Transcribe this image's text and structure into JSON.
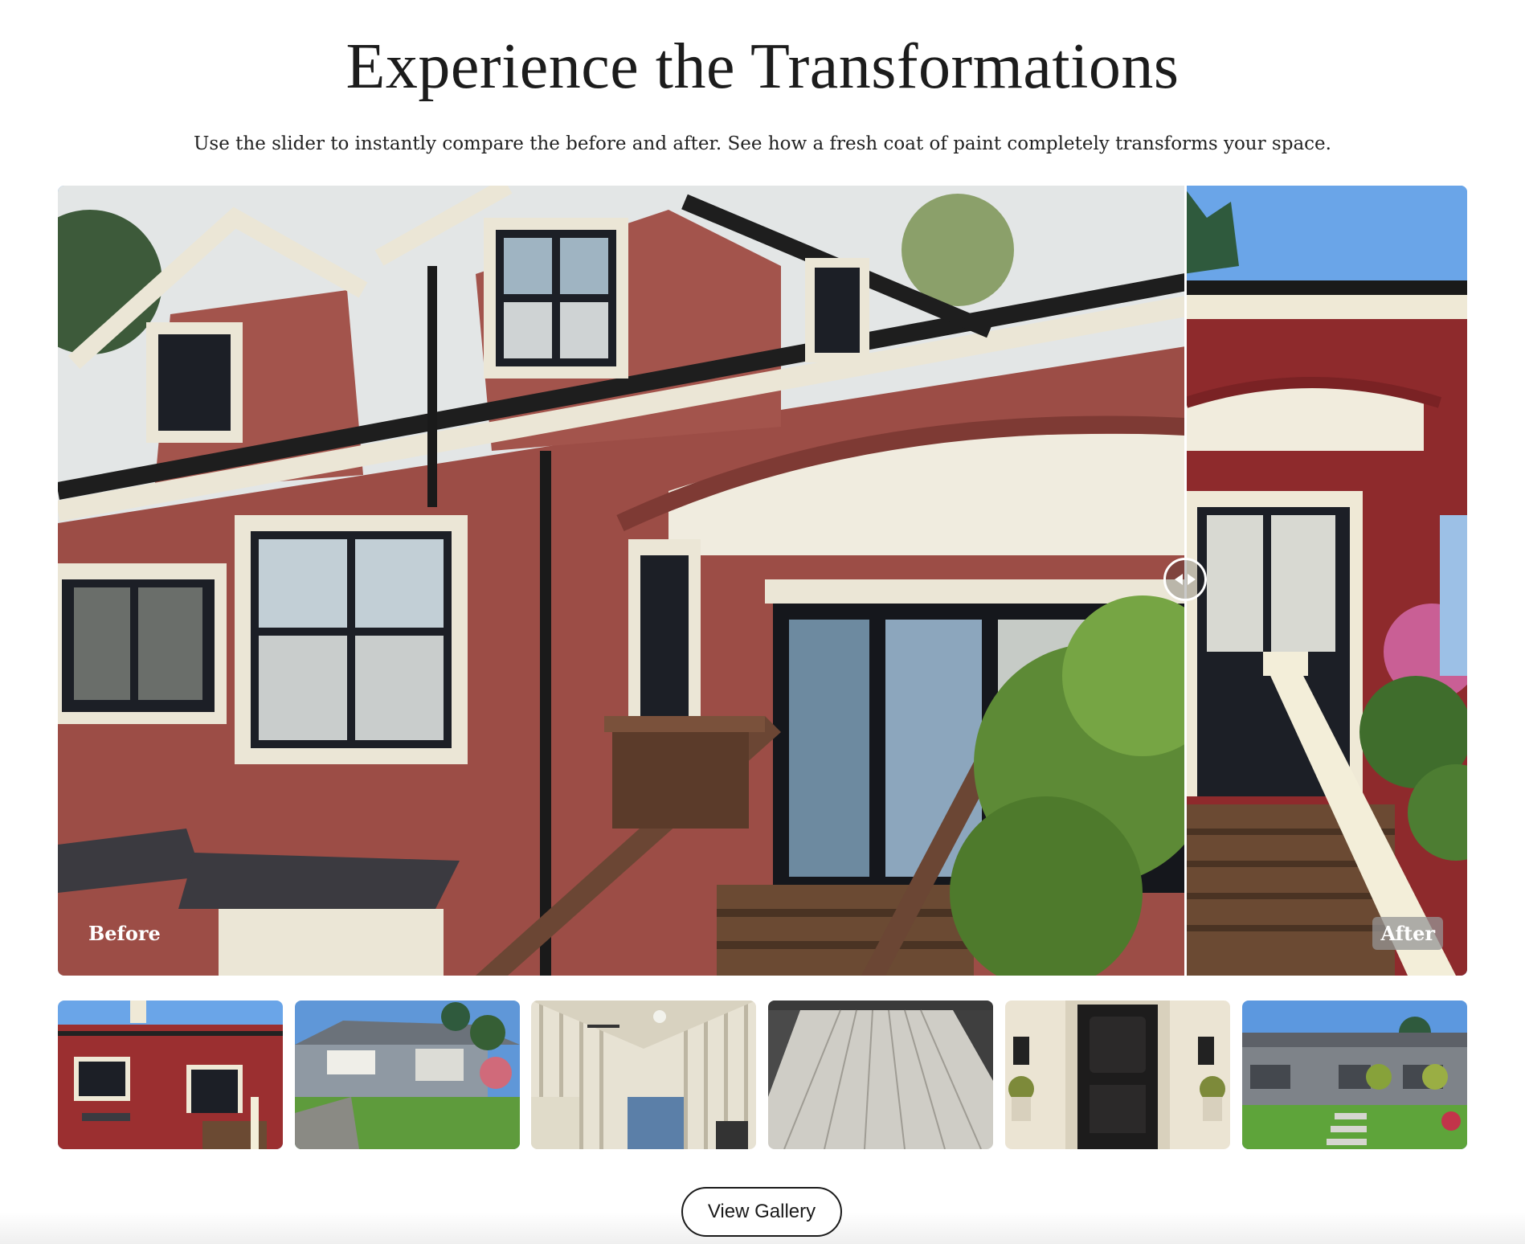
{
  "section": {
    "title": "Experience the Transformations",
    "subtitle": "Use the slider to instantly compare the before and after. See how a fresh coat of paint completely transforms your space."
  },
  "comparison": {
    "before_label": "Before",
    "after_label": "After",
    "slider_position_fraction": 0.8
  },
  "thumbnails": [
    {
      "name": "red-shingle-house"
    },
    {
      "name": "grey-bungalow"
    },
    {
      "name": "striped-interior-ceiling"
    },
    {
      "name": "painted-deck-boards"
    },
    {
      "name": "black-front-door"
    },
    {
      "name": "modern-grey-house"
    }
  ],
  "actions": {
    "view_gallery_label": "View Gallery"
  },
  "colors": {
    "before_siding": "#9c4d46",
    "after_siding": "#8e2a2c",
    "trim": "#efe9d6",
    "window_frame": "#1c1f26",
    "button_border": "#1a1a1a"
  }
}
